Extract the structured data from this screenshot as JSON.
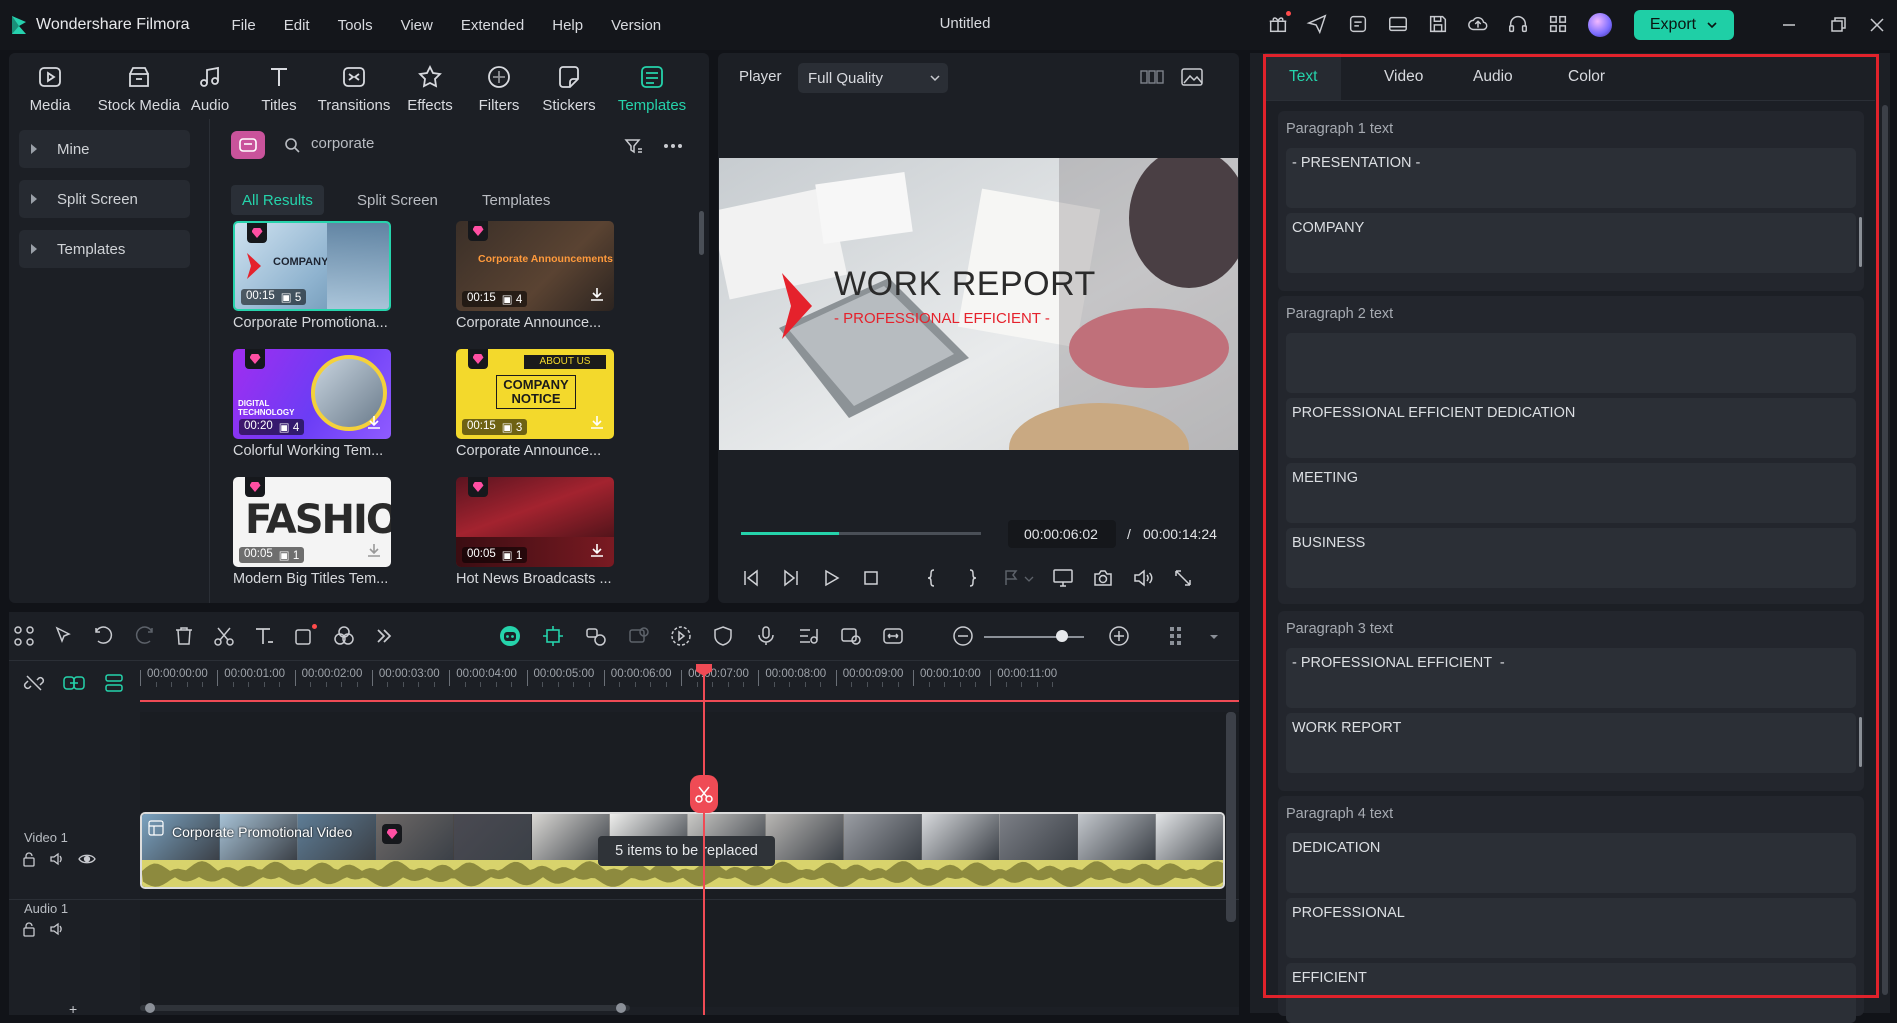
{
  "app": {
    "name": "Wondershare Filmora",
    "doc_title": "Untitled",
    "export_label": "Export"
  },
  "menu": [
    "File",
    "Edit",
    "Tools",
    "View",
    "Extended",
    "Help",
    "Version"
  ],
  "media_tabs": [
    {
      "label": "Media",
      "icon": "media-icon"
    },
    {
      "label": "Stock Media",
      "icon": "stock-media-icon"
    },
    {
      "label": "Audio",
      "icon": "audio-icon"
    },
    {
      "label": "Titles",
      "icon": "titles-icon"
    },
    {
      "label": "Transitions",
      "icon": "transitions-icon"
    },
    {
      "label": "Effects",
      "icon": "effects-icon"
    },
    {
      "label": "Filters",
      "icon": "filters-icon"
    },
    {
      "label": "Stickers",
      "icon": "stickers-icon"
    },
    {
      "label": "Templates",
      "icon": "templates-icon",
      "active": true
    }
  ],
  "categories": [
    "Mine",
    "Split Screen",
    "Templates"
  ],
  "search": {
    "value": "corporate"
  },
  "filter_tabs": [
    "All Results",
    "Split Screen",
    "Templates"
  ],
  "templates": [
    {
      "label": "Corporate Promotiona...",
      "duration": "00:15",
      "count": "5",
      "thumb_text": "COMPANY"
    },
    {
      "label": "Corporate Announce...",
      "duration": "00:15",
      "count": "4",
      "thumb_text": "Corporate Announcements"
    },
    {
      "label": "Colorful Working Tem...",
      "duration": "00:20",
      "count": "4",
      "thumb_text": "DIGITAL TECHNOLOGY"
    },
    {
      "label": "Corporate Announce...",
      "duration": "00:15",
      "count": "3",
      "thumb_text": "COMPANY NOTICE",
      "thumb_text2": "ABOUT US"
    },
    {
      "label": "Modern Big Titles Tem...",
      "duration": "00:05",
      "count": "1",
      "thumb_text": "FASHION"
    },
    {
      "label": "Hot News Broadcasts ...",
      "duration": "00:05",
      "count": "1"
    }
  ],
  "player": {
    "label": "Player",
    "quality": "Full Quality",
    "current_time": "00:00:06:02",
    "separator": "/",
    "total_time": "00:00:14:24",
    "progress": 0.41,
    "video_title": "WORK REPORT",
    "video_subtitle": "- PROFESSIONAL EFFICIENT -"
  },
  "right_panel": {
    "tabs": [
      "Text",
      "Video",
      "Audio",
      "Color"
    ],
    "paragraphs": [
      {
        "title": "Paragraph 1 text",
        "fields": [
          "- PRESENTATION -",
          "COMPANY"
        ]
      },
      {
        "title": "Paragraph 2 text",
        "fields": [
          "",
          "PROFESSIONAL EFFICIENT DEDICATION",
          "MEETING",
          "BUSINESS"
        ]
      },
      {
        "title": "Paragraph 3 text",
        "fields": [
          "- PROFESSIONAL EFFICIENT  -",
          "WORK REPORT"
        ]
      },
      {
        "title": "Paragraph 4 text",
        "fields": [
          "DEDICATION",
          "PROFESSIONAL",
          "EFFICIENT"
        ]
      }
    ]
  },
  "timeline": {
    "ruler": [
      "00:00:00:00",
      "00:00:01:00",
      "00:00:02:00",
      "00:00:03:00",
      "00:00:04:00",
      "00:00:05:00",
      "00:00:06:00",
      "00:00:07:00",
      "00:00:08:00",
      "00:00:09:00",
      "00:00:10:00",
      "00:00:11:00"
    ],
    "tracks": {
      "video": "Video 1",
      "audio": "Audio 1"
    },
    "clip_title": "Corporate Promotional Video",
    "tooltip": "5 items to be replaced",
    "add_track": "+"
  },
  "colors": {
    "accent": "#25d3ab",
    "highlight": "#e0222b",
    "playhead": "#ef4b55"
  }
}
